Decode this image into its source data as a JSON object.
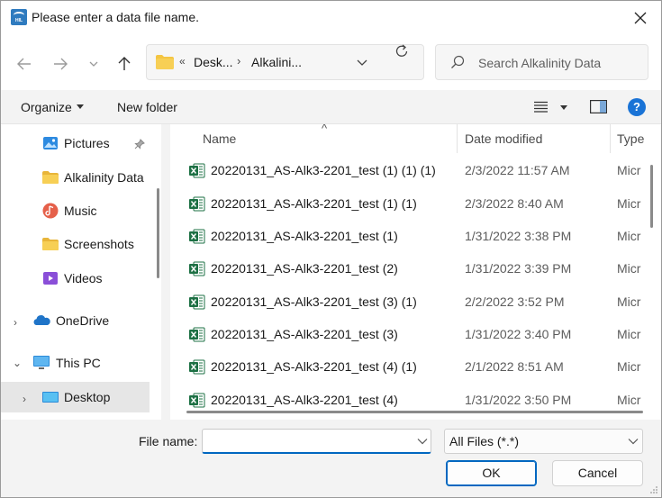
{
  "window": {
    "title": "Please enter a data file name.",
    "app_icon_text": "HIL"
  },
  "address": {
    "overflow": "«",
    "segments": [
      "Desk...",
      "Alkalini..."
    ]
  },
  "search": {
    "placeholder": "Search Alkalinity Data"
  },
  "commandbar": {
    "organize": "Organize",
    "new_folder": "New folder",
    "help": "?"
  },
  "navpane": {
    "items": [
      {
        "label": "Pictures",
        "icon": "pictures-icon",
        "pinned": true
      },
      {
        "label": "Alkalinity Data",
        "icon": "folder-icon"
      },
      {
        "label": "Music",
        "icon": "music-icon"
      },
      {
        "label": "Screenshots",
        "icon": "folder-icon"
      },
      {
        "label": "Videos",
        "icon": "videos-icon"
      },
      {
        "label": "OneDrive",
        "icon": "cloud-icon",
        "expander": "›"
      },
      {
        "label": "This PC",
        "icon": "pc-icon",
        "expander": "⌄"
      },
      {
        "label": "Desktop",
        "icon": "desktop-icon",
        "expander": "›",
        "selected": true
      }
    ]
  },
  "filelist": {
    "columns": {
      "name": "Name",
      "date": "Date modified",
      "type": "Type"
    },
    "rows": [
      {
        "name": "20220131_AS-Alk3-2201_test (1) (1) (1)",
        "date": "2/3/2022 11:57 AM",
        "type": "Micr"
      },
      {
        "name": "20220131_AS-Alk3-2201_test (1) (1)",
        "date": "2/3/2022 8:40 AM",
        "type": "Micr"
      },
      {
        "name": "20220131_AS-Alk3-2201_test (1)",
        "date": "1/31/2022 3:38 PM",
        "type": "Micr"
      },
      {
        "name": "20220131_AS-Alk3-2201_test (2)",
        "date": "1/31/2022 3:39 PM",
        "type": "Micr"
      },
      {
        "name": "20220131_AS-Alk3-2201_test (3) (1)",
        "date": "2/2/2022 3:52 PM",
        "type": "Micr"
      },
      {
        "name": "20220131_AS-Alk3-2201_test (3)",
        "date": "1/31/2022 3:40 PM",
        "type": "Micr"
      },
      {
        "name": "20220131_AS-Alk3-2201_test (4) (1)",
        "date": "2/1/2022 8:51 AM",
        "type": "Micr"
      },
      {
        "name": "20220131_AS-Alk3-2201_test (4)",
        "date": "1/31/2022 3:50 PM",
        "type": "Micr"
      }
    ]
  },
  "bottom": {
    "file_name_label": "File name:",
    "file_name_value": "",
    "file_type": "All Files (*.*)",
    "ok": "OK",
    "cancel": "Cancel"
  },
  "colors": {
    "accent": "#0067c0",
    "excel_green": "#1d7044",
    "folder_yellow": "#f4c542"
  }
}
